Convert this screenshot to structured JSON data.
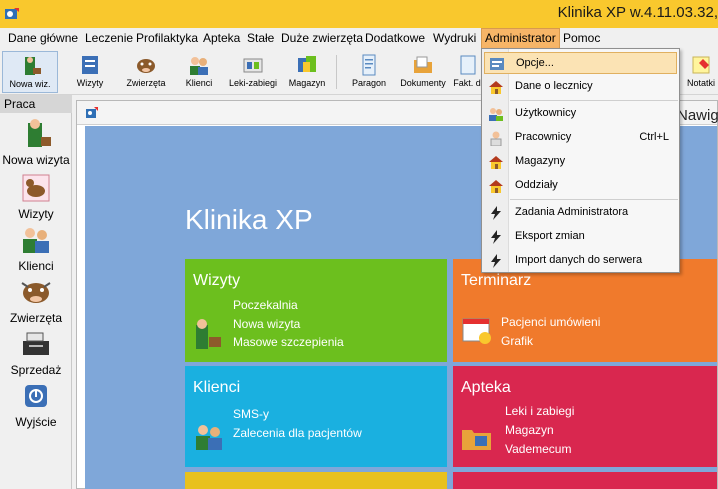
{
  "window": {
    "title": "Klinika XP w.4.11.03.32, "
  },
  "menubar": {
    "items": [
      "Dane główne",
      "Leczenie",
      "Profilaktyka",
      "Apteka",
      "Stałe",
      "Duże zwierzęta",
      "Dodatkowe",
      "Wydruki",
      "Administrator",
      "Pomoc"
    ],
    "active": "Administrator"
  },
  "toolbar": {
    "items": [
      "Nowa wiz.",
      "Wizyty",
      "Zwierzęta",
      "Klienci",
      "Leki-zabiegi",
      "Magazyn",
      "Paragon",
      "Dokumenty",
      "Fakt. d",
      "Notatki"
    ]
  },
  "sidebar": {
    "header": "Praca",
    "items": [
      "Nowa wizyta",
      "Wizyty",
      "Klienci",
      "Zwierzęta",
      "Sprzedaż",
      "Wyjście"
    ]
  },
  "content": {
    "nav_label": "Nawig",
    "title": "Klinika XP",
    "tiles": {
      "wizyty": {
        "title": "Wizyty",
        "links": [
          "Poczekalnia",
          "Nowa wizyta",
          "Masowe szczepienia"
        ],
        "color": "#6cbf1e"
      },
      "terminarz": {
        "title": "Terminarz",
        "links": [
          "Pacjenci umówieni",
          "Grafik"
        ],
        "color": "#f07a2c"
      },
      "klienci": {
        "title": "Klienci",
        "links": [
          "SMS-y",
          "Zalecenia dla pacjentów"
        ],
        "color": "#1ab0e0"
      },
      "apteka": {
        "title": "Apteka",
        "links": [
          "Leki i zabiegi",
          "Magazyn",
          "Vademecum"
        ],
        "color": "#d9274f"
      }
    }
  },
  "dropdown": {
    "items": [
      {
        "label": "Opcje...",
        "shortcut": ""
      },
      {
        "label": "Dane o lecznicy",
        "shortcut": ""
      },
      {
        "label": "Użytkownicy",
        "shortcut": ""
      },
      {
        "label": "Pracownicy",
        "shortcut": "Ctrl+L"
      },
      {
        "label": "Magazyny",
        "shortcut": ""
      },
      {
        "label": "Oddziały",
        "shortcut": ""
      },
      {
        "label": "Zadania Administratora",
        "shortcut": ""
      },
      {
        "label": "Eksport zmian",
        "shortcut": ""
      },
      {
        "label": "Import danych do serwera",
        "shortcut": ""
      }
    ],
    "highlighted": "Opcje..."
  },
  "colors": {
    "title_bar": "#f9c82d",
    "dashboard_bg": "#7fa7d9",
    "menu_active": "#f7b567",
    "tile_bottom_left": "#e8c11d",
    "tile_bottom_right": "#d9274f"
  }
}
